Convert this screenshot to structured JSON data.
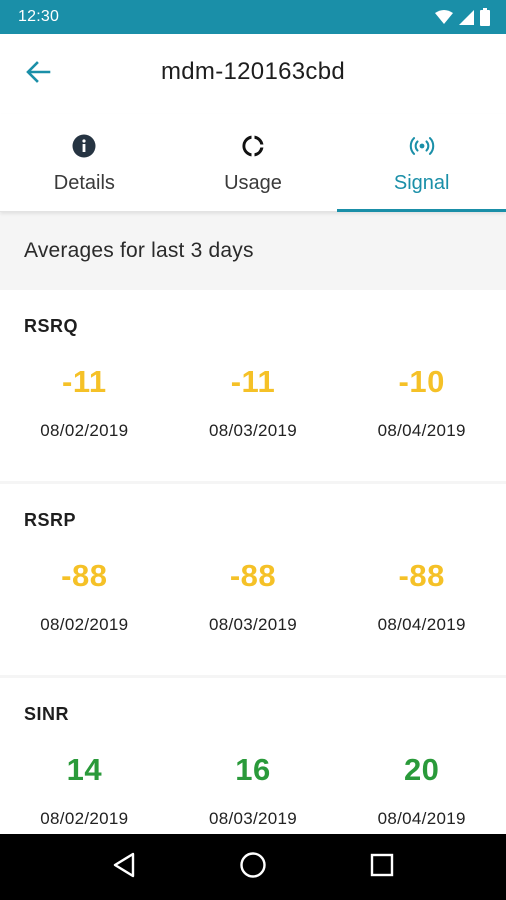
{
  "status_bar": {
    "time": "12:30",
    "icons": [
      "wifi-icon",
      "cell-signal-icon",
      "battery-icon"
    ]
  },
  "app_bar": {
    "title": "mdm-120163cbd",
    "back_icon": "arrow-back-icon"
  },
  "tabs": [
    {
      "label": "Details",
      "icon": "info-icon",
      "active": false
    },
    {
      "label": "Usage",
      "icon": "donut-chart-icon",
      "active": false
    },
    {
      "label": "Signal",
      "icon": "signal-broadcast-icon",
      "active": true
    }
  ],
  "section": {
    "heading": "Averages for last 3 days"
  },
  "metrics": [
    {
      "name": "RSRQ",
      "color": "#f5c127",
      "readings": [
        {
          "value": "-11",
          "date": "08/02/2019"
        },
        {
          "value": "-11",
          "date": "08/03/2019"
        },
        {
          "value": "-10",
          "date": "08/04/2019"
        }
      ]
    },
    {
      "name": "RSRP",
      "color": "#f5c127",
      "readings": [
        {
          "value": "-88",
          "date": "08/02/2019"
        },
        {
          "value": "-88",
          "date": "08/03/2019"
        },
        {
          "value": "-88",
          "date": "08/04/2019"
        }
      ]
    },
    {
      "name": "SINR",
      "color": "#2a9a3a",
      "readings": [
        {
          "value": "14",
          "date": "08/02/2019"
        },
        {
          "value": "16",
          "date": "08/03/2019"
        },
        {
          "value": "20",
          "date": "08/04/2019"
        }
      ]
    }
  ],
  "colors": {
    "accent": "#1a8fa8",
    "warning_value": "#f5c127",
    "good_value": "#2a9a3a"
  },
  "nav_bar": {
    "icons": [
      "back-triangle-icon",
      "home-circle-icon",
      "recents-square-icon"
    ]
  }
}
